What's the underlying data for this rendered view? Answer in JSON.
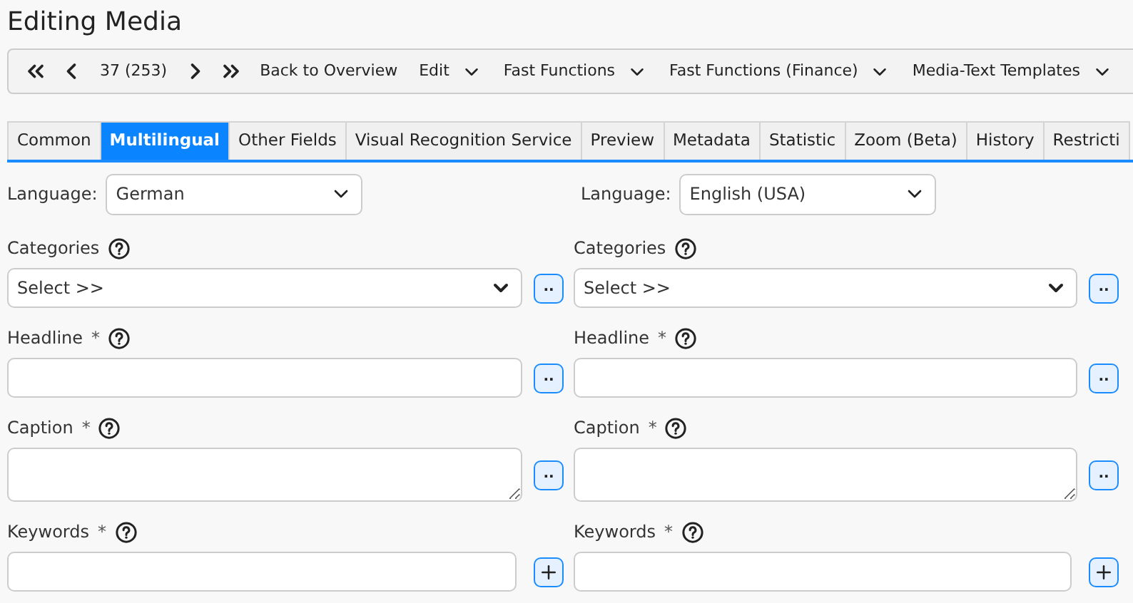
{
  "page_title": "Editing Media",
  "toolbar": [
    {
      "kind": "first"
    },
    {
      "kind": "prev"
    },
    {
      "kind": "text",
      "label": "37 (253)"
    },
    {
      "kind": "next"
    },
    {
      "kind": "last"
    },
    {
      "kind": "link",
      "label": "Back to Overview"
    },
    {
      "kind": "menu",
      "label": "Edit"
    },
    {
      "kind": "menu",
      "label": "Fast Functions"
    },
    {
      "kind": "menu",
      "label": "Fast Functions (Finance)"
    },
    {
      "kind": "menu",
      "label": "Media-Text Templates"
    }
  ],
  "tabs": [
    {
      "label": "Common",
      "selected": false
    },
    {
      "label": "Multilingual",
      "selected": true
    },
    {
      "label": "Other Fields",
      "selected": false
    },
    {
      "label": "Visual Recognition Service",
      "selected": false
    },
    {
      "label": "Preview",
      "selected": false
    },
    {
      "label": "Metadata",
      "selected": false
    },
    {
      "label": "Statistic",
      "selected": false
    },
    {
      "label": "Zoom (Beta)",
      "selected": false
    },
    {
      "label": "History",
      "selected": false
    },
    {
      "label": "Restricti",
      "selected": false
    }
  ],
  "columns": [
    {
      "language": {
        "label": "Language:",
        "value": "German"
      },
      "fields": [
        {
          "kind": "select",
          "label": "Categories",
          "value": "Select >>",
          "action": {
            "kind": "more",
            "label": ".."
          }
        },
        {
          "kind": "input",
          "label": "Headline",
          "required_mark": "*",
          "action": {
            "kind": "more",
            "label": ".."
          }
        },
        {
          "kind": "textarea",
          "label": "Caption",
          "required_mark": "*",
          "action": {
            "kind": "more",
            "label": ".."
          }
        },
        {
          "kind": "input",
          "label": "Keywords",
          "required_mark": "*",
          "action": {
            "kind": "add"
          }
        }
      ]
    },
    {
      "language": {
        "label": "Language:",
        "value": "English (USA)"
      },
      "fields": [
        {
          "kind": "select",
          "label": "Categories",
          "value": "Select >>",
          "action": {
            "kind": "more",
            "label": ".."
          }
        },
        {
          "kind": "input",
          "label": "Headline",
          "required_mark": "*",
          "action": {
            "kind": "more",
            "label": ".."
          }
        },
        {
          "kind": "textarea",
          "label": "Caption",
          "required_mark": "*",
          "action": {
            "kind": "more",
            "label": ".."
          }
        },
        {
          "kind": "input",
          "label": "Keywords",
          "required_mark": "*",
          "action": {
            "kind": "add"
          }
        }
      ]
    }
  ]
}
